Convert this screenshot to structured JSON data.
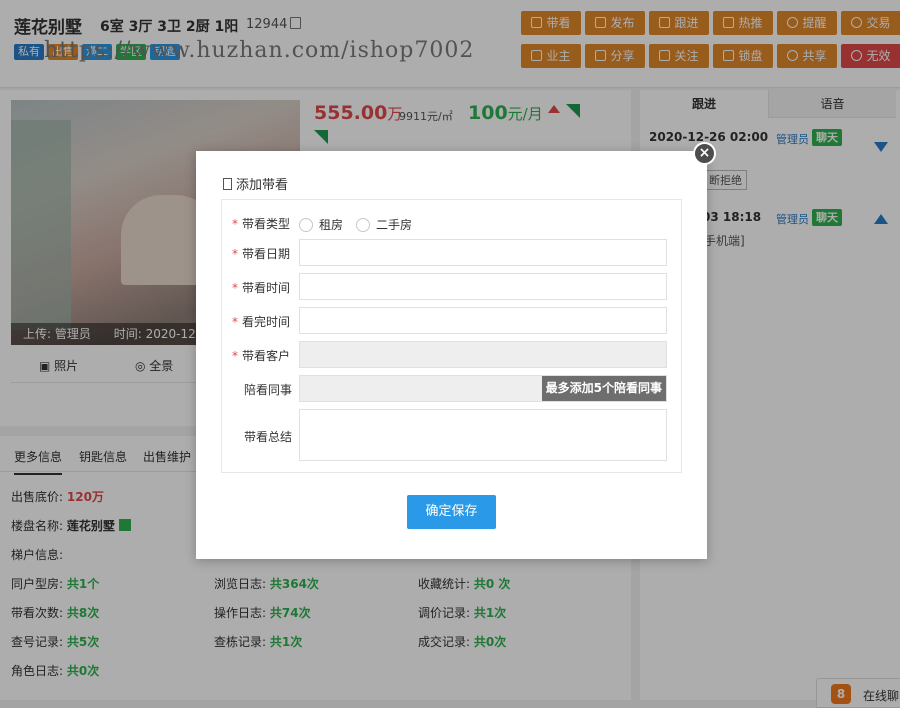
{
  "header": {
    "title": "莲花别墅",
    "layout": "6室 3厅 3卫 2厨 1阳",
    "listing_id": "12944",
    "tags": [
      {
        "label": "私有",
        "color": "#2a7cc7"
      },
      {
        "label": "出售",
        "color": "#e0882c"
      },
      {
        "label": "满二",
        "color": "#2a9ae8"
      },
      {
        "label": "学区",
        "color": "#2fb14f"
      },
      {
        "label": "钥匙",
        "color": "#2a9ae8"
      }
    ],
    "watermark": "https://www.huzhan.com/ishop7002",
    "actions_row1": [
      "带看",
      "发布",
      "跟进",
      "热推",
      "提醒",
      "交易"
    ],
    "actions_row2": [
      "业主",
      "分享",
      "关注",
      "锁盘",
      "共享",
      "无效"
    ]
  },
  "listing": {
    "price": "555.00",
    "price_unit": "万",
    "unit_price": "9911元/㎡",
    "rent": "100",
    "rent_unit": "元/月",
    "photo_caption_uploader": "上传: 管理员",
    "photo_caption_time": "时间: 2020-12",
    "photo_tabs": [
      "照片",
      "全景"
    ]
  },
  "more_info": {
    "tabs": [
      "更多信息",
      "钥匙信息",
      "出售维护"
    ],
    "floor_price_label": "出售底价:",
    "floor_price_value": "120万",
    "estate_label": "楼盘名称:",
    "estate_value": "莲花别墅",
    "ladder_label": "梯户信息:",
    "stats": [
      {
        "label": "同户型房:",
        "value": "共1个"
      },
      {
        "label": "浏览日志:",
        "value": "共364次"
      },
      {
        "label": "收藏统计:",
        "value": "共0 次"
      },
      {
        "label": "带看次数:",
        "value": "共8次"
      },
      {
        "label": "操作日志:",
        "value": "共74次"
      },
      {
        "label": "调价记录:",
        "value": "共1次"
      },
      {
        "label": "查号记录:",
        "value": "共5次"
      },
      {
        "label": "查栋记录:",
        "value": "共1次"
      },
      {
        "label": "成交记录:",
        "value": "共0次"
      },
      {
        "label": "角色日志:",
        "value": "共0次"
      }
    ]
  },
  "side_panel": {
    "tabs": [
      "跟进",
      "语音"
    ],
    "logs": [
      {
        "date": "2020-12-26 02:00",
        "user": "管理员",
        "chat": "聊天",
        "note": "断拒绝"
      },
      {
        "date": "03 18:18",
        "user": "管理员",
        "chat": "聊天",
        "note": "手机端]"
      }
    ]
  },
  "chat_float": {
    "badge": "8",
    "label": "在线聊"
  },
  "modal": {
    "title": "添加带看",
    "close": "×",
    "fields": {
      "type_label": "带看类型",
      "type_options": [
        "租房",
        "二手房"
      ],
      "date_label": "带看日期",
      "time_label": "带看时间",
      "end_label": "看完时间",
      "customer_label": "带看客户",
      "colleague_label": "陪看同事",
      "colleague_button": "最多添加5个陪看同事",
      "summary_label": "带看总结"
    },
    "save_button": "确定保存"
  },
  "colors": {
    "orange": "#e0882c",
    "red": "#e04a4a",
    "green": "#2fb14f",
    "blue": "#2a9ae8"
  }
}
